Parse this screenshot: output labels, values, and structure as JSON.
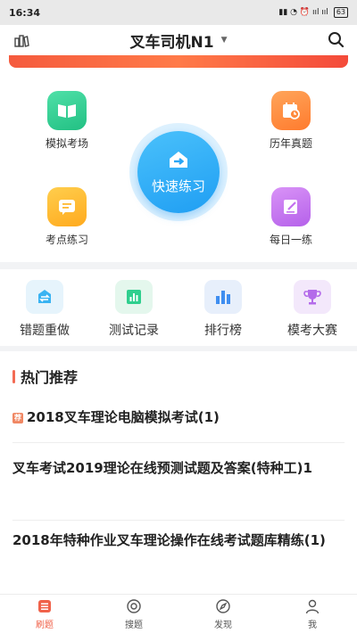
{
  "status_bar": {
    "time": "16:34",
    "indicators": "▮▮ ◔ ⏰ ııl ııl",
    "battery": "63"
  },
  "header": {
    "title": "叉车司机N1",
    "caret": "▼",
    "left_icon": "book-stack-icon",
    "right_icon": "search-icon"
  },
  "features": {
    "mock_exam": "模拟考场",
    "past_papers": "历年真题",
    "quick_practice": "快速练习",
    "topic_practice": "考点练习",
    "daily_practice": "每日一练"
  },
  "tools": {
    "wrong_redo": "错题重做",
    "test_records": "测试记录",
    "ranking": "排行榜",
    "mock_contest": "模考大赛"
  },
  "hot_section": {
    "title": "热门推荐",
    "hot_tag": "荐",
    "items": [
      "2018叉车理论电脑模拟考试(1)",
      "叉车考试2019理论在线预测试题及答案(特种工)1",
      "2018年特种作业叉车理论操作在线考试题库精练(1)"
    ]
  },
  "bottom_nav": {
    "tabs": [
      "刷题",
      "搜题",
      "发现",
      "我"
    ],
    "active_tab": "刷题"
  },
  "colors": {
    "accent": "#f0624a",
    "quick_blue": "#1f9ef3",
    "green": "#2fcf8e",
    "orange": "#ff8a3d",
    "yellow": "#ffb82e",
    "purple": "#c371ef"
  }
}
